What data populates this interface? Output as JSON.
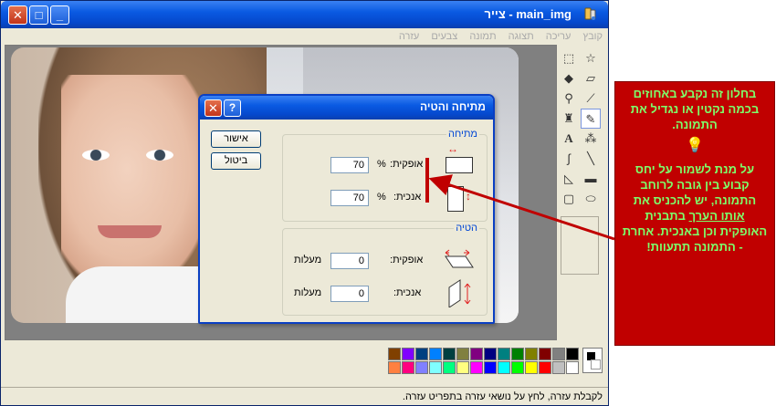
{
  "window": {
    "title": "main_img - צייר",
    "menu": [
      "קובץ",
      "עריכה",
      "תצוגה",
      "תמונה",
      "צבעים",
      "עזרה"
    ]
  },
  "toolbox": {
    "tools": [
      "free-select",
      "rect-select",
      "eraser",
      "fill",
      "color-picker",
      "magnifier",
      "pencil",
      "brush",
      "airbrush",
      "text",
      "line",
      "curve",
      "rectangle",
      "polygon",
      "ellipse",
      "rounded-rectangle"
    ]
  },
  "palette": {
    "row1": [
      "#000000",
      "#808080",
      "#800000",
      "#808000",
      "#008000",
      "#008080",
      "#000080",
      "#800080",
      "#808040",
      "#004040",
      "#0080ff",
      "#004080",
      "#8000ff",
      "#804000"
    ],
    "row2": [
      "#ffffff",
      "#c0c0c0",
      "#ff0000",
      "#ffff00",
      "#00ff00",
      "#00ffff",
      "#0000ff",
      "#ff00ff",
      "#ffff80",
      "#00ff80",
      "#80ffff",
      "#8080ff",
      "#ff0080",
      "#ff8040"
    ]
  },
  "status": {
    "text": "לקבלת עזרה, לחץ על נושאי עזרה בתפריט עזרה."
  },
  "dialog": {
    "title": "מתיחה והטיה",
    "ok_label": "אישור",
    "cancel_label": "ביטול",
    "stretch": {
      "title": "מתיחה",
      "horizontal_label": "אופקית:",
      "horizontal_value": "70",
      "vertical_label": "אנכית:",
      "vertical_value": "70",
      "unit": "%"
    },
    "skew": {
      "title": "הטיה",
      "horizontal_label": "אופקית:",
      "horizontal_value": "0",
      "vertical_label": "אנכית:",
      "vertical_value": "0",
      "unit": "מעלות"
    }
  },
  "callout": {
    "text1": "בחלון זה נקבע באחוזים בכמה נקטין או נגדיל את התמונה.",
    "text2_a": "על מנת לשמור על יחס קבוע בין גובה לרוחב התמונה, יש להכניס את",
    "text2_u": "אותו הערך",
    "text2_b": "בתבנית האופקית וכן באנכית. אחרת - התמונה תתעוות!"
  }
}
